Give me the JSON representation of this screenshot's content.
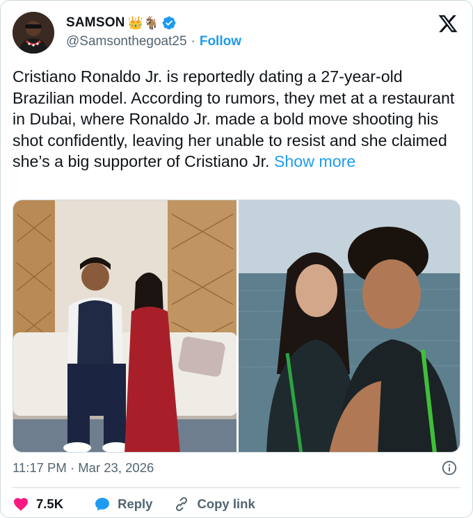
{
  "author": {
    "display_name": "SAMSON",
    "name_emojis": "👑🐐",
    "verified": true,
    "handle": "@Samsonthegoat25",
    "separator": "·",
    "follow_label": "Follow"
  },
  "tweet": {
    "text": "Cristiano Ronaldo Jr. is reportedly dating a 27-year-old Brazilian model. According to rumors, they met at a restaurant in Dubai, where Ronaldo Jr. made a bold move shooting his shot confidently, leaving her unable to resist and she claimed she’s a big supporter of Cristiano Jr.",
    "show_more_label": "Show more",
    "timestamp": "11:17 PM · Mar 23, 2026"
  },
  "actions": {
    "like_count": "7.5K",
    "reply_label": "Reply",
    "copy_link_label": "Copy link"
  },
  "icons": {
    "logo": "x-logo-icon",
    "verified": "verified-badge-icon",
    "info": "info-icon",
    "like": "heart-icon",
    "reply": "reply-bubble-icon",
    "copy": "link-icon"
  },
  "colors": {
    "accent": "#1d9bf0",
    "like": "#f91880",
    "muted": "#536471",
    "text": "#0f1419"
  }
}
